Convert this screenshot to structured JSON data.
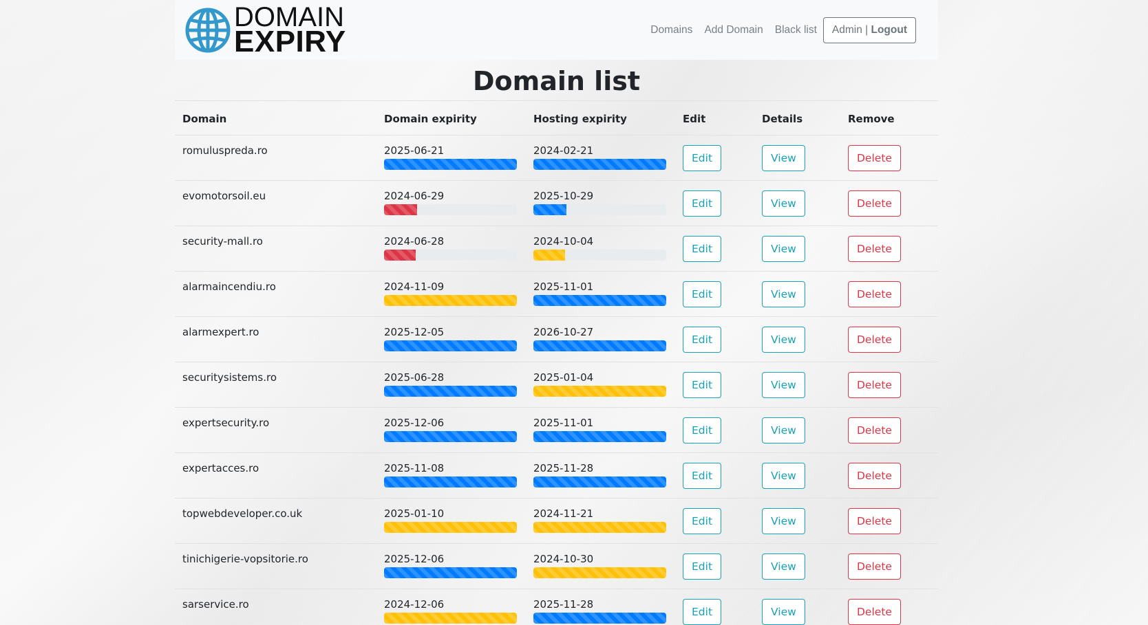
{
  "brand": {
    "line1": "DOMAIN",
    "line2": "EXPIRY",
    "logo_icon": "globe-icon",
    "logo_color": "#3399cc"
  },
  "nav": {
    "domains": "Domains",
    "add_domain": "Add Domain",
    "black_list": "Black list",
    "admin": "Admin",
    "separator": "|",
    "logout": "Logout"
  },
  "page_title": "Domain list",
  "table": {
    "headers": [
      "Domain",
      "Domain expirity",
      "Hosting expirity",
      "Edit",
      "Details",
      "Remove"
    ],
    "edit_label": "Edit",
    "view_label": "View",
    "delete_label": "Delete",
    "status_colors": {
      "ok": "#007bff",
      "warning": "#ffc107",
      "danger": "#dc3545"
    },
    "rows": [
      {
        "domain": "romuluspreda.ro",
        "domain_expiry": "2025-06-21",
        "domain_status": "ok",
        "domain_fill": 1.0,
        "hosting_expiry": "2024-02-21",
        "hosting_status": "ok",
        "hosting_fill": 1.0
      },
      {
        "domain": "evomotorsoil.eu",
        "domain_expiry": "2024-06-29",
        "domain_status": "danger",
        "domain_fill": 0.25,
        "hosting_expiry": "2025-10-29",
        "hosting_status": "ok",
        "hosting_fill": 0.25
      },
      {
        "domain": "security-mall.ro",
        "domain_expiry": "2024-06-28",
        "domain_status": "danger",
        "domain_fill": 0.24,
        "hosting_expiry": "2024-10-04",
        "hosting_status": "warning",
        "hosting_fill": 0.24
      },
      {
        "domain": "alarmaincendiu.ro",
        "domain_expiry": "2024-11-09",
        "domain_status": "warning",
        "domain_fill": 1.0,
        "hosting_expiry": "2025-11-01",
        "hosting_status": "ok",
        "hosting_fill": 1.0
      },
      {
        "domain": "alarmexpert.ro",
        "domain_expiry": "2025-12-05",
        "domain_status": "ok",
        "domain_fill": 1.0,
        "hosting_expiry": "2026-10-27",
        "hosting_status": "ok",
        "hosting_fill": 1.0
      },
      {
        "domain": "securitysistems.ro",
        "domain_expiry": "2025-06-28",
        "domain_status": "ok",
        "domain_fill": 1.0,
        "hosting_expiry": "2025-01-04",
        "hosting_status": "warning",
        "hosting_fill": 1.0
      },
      {
        "domain": "expertsecurity.ro",
        "domain_expiry": "2025-12-06",
        "domain_status": "ok",
        "domain_fill": 1.0,
        "hosting_expiry": "2025-11-01",
        "hosting_status": "ok",
        "hosting_fill": 1.0
      },
      {
        "domain": "expertacces.ro",
        "domain_expiry": "2025-11-08",
        "domain_status": "ok",
        "domain_fill": 1.0,
        "hosting_expiry": "2025-11-28",
        "hosting_status": "ok",
        "hosting_fill": 1.0
      },
      {
        "domain": "topwebdeveloper.co.uk",
        "domain_expiry": "2025-01-10",
        "domain_status": "warning",
        "domain_fill": 1.0,
        "hosting_expiry": "2024-11-21",
        "hosting_status": "warning",
        "hosting_fill": 1.0
      },
      {
        "domain": "tinichigerie-vopsitorie.ro",
        "domain_expiry": "2025-12-06",
        "domain_status": "ok",
        "domain_fill": 1.0,
        "hosting_expiry": "2024-10-30",
        "hosting_status": "warning",
        "hosting_fill": 1.0
      },
      {
        "domain": "sarservice.ro",
        "domain_expiry": "2024-12-06",
        "domain_status": "warning",
        "domain_fill": 1.0,
        "hosting_expiry": "2025-11-28",
        "hosting_status": "ok",
        "hosting_fill": 1.0
      }
    ]
  }
}
